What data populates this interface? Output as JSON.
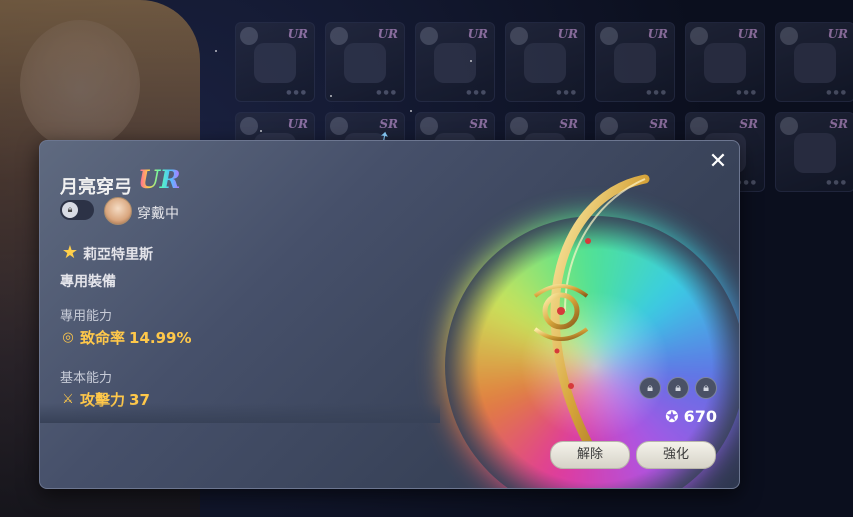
{
  "dialog": {
    "item_name": "月亮穿弓",
    "rank": "UR",
    "lock_icon": "lock-icon",
    "equip_status": "穿戴中",
    "character_name": "莉亞特里斯",
    "exclusive_label": "專用裝備",
    "exclusive_ability_header": "專用能力",
    "exclusive_stats": [
      {
        "icon": "crit-rate-icon",
        "name": "致命率",
        "value": "14.99%"
      }
    ],
    "base_ability_header": "基本能力",
    "base_stats": [
      {
        "icon": "sword-icon",
        "name": "攻擊力",
        "value": "37"
      }
    ],
    "score": "670",
    "unequip_button": "解除",
    "enhance_button": "強化",
    "close_icon": "close-icon"
  },
  "background_tiles": [
    {
      "rank": "UR"
    },
    {
      "rank": "UR"
    },
    {
      "rank": "UR"
    },
    {
      "rank": "UR"
    },
    {
      "rank": "UR"
    },
    {
      "rank": "UR"
    },
    {
      "rank": "UR"
    },
    {
      "rank": "UR"
    },
    {
      "rank": "SR"
    },
    {
      "rank": "SR"
    },
    {
      "rank": "SR"
    },
    {
      "rank": "SR"
    },
    {
      "rank": "SR"
    },
    {
      "rank": "SR"
    }
  ],
  "colors": {
    "stat_gold": "#ffc84a",
    "dialog_bg": "#46506a",
    "button_bg": "#f4f2ea"
  }
}
